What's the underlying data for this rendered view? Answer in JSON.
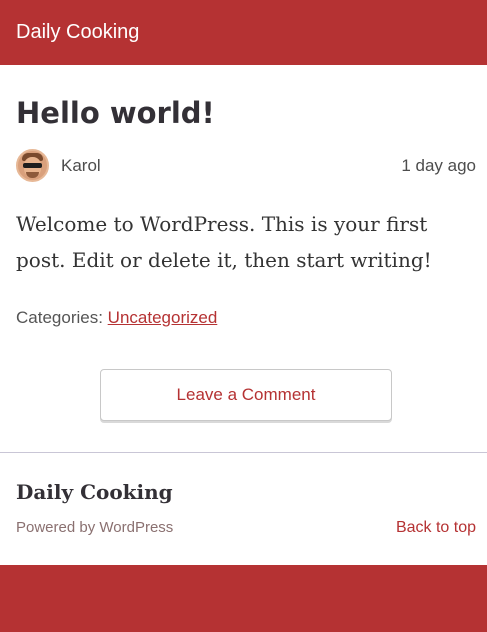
{
  "header": {
    "site_title": "Daily Cooking",
    "background_color": "#b53233"
  },
  "post": {
    "title": "Hello world!",
    "author": "Karol",
    "date": "1 day ago",
    "avatar_icon": "user-avatar-icon",
    "content": "Welcome to WordPress. This is your first post. Edit or delete it, then start writing!",
    "categories_label": "Categories:",
    "category": "Uncategorized"
  },
  "actions": {
    "leave_comment_label": "Leave a Comment"
  },
  "footer": {
    "site_title": "Daily Cooking",
    "powered_by": "Powered by WordPress",
    "back_to_top": "Back to top"
  },
  "colors": {
    "accent": "#b53233",
    "text": "#333333"
  }
}
